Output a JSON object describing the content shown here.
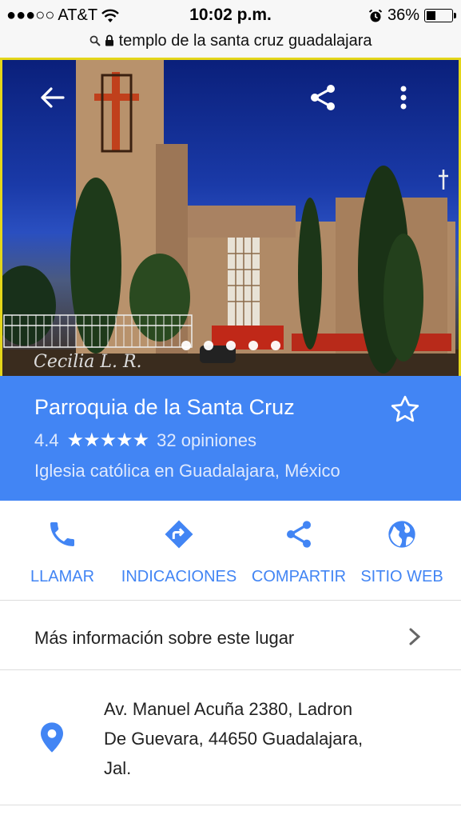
{
  "status_bar": {
    "signal": "●●●○○",
    "carrier": "AT&T",
    "time": "10:02 p.m.",
    "battery_percent": "36%",
    "battery_level": 0.36
  },
  "url_bar": {
    "query": "templo de la santa cruz guadalajara"
  },
  "hero": {
    "watermark": "Cecilia L. R.",
    "photo_count": 5,
    "active_photo": 0
  },
  "place": {
    "name": "Parroquia de la Santa Cruz",
    "rating": "4.4",
    "stars": "★★★★★",
    "reviews": "32 opiniones",
    "category": "Iglesia católica en Guadalajara, México"
  },
  "actions": {
    "call": "LLAMAR",
    "directions": "INDICACIONES",
    "share": "COMPARTIR",
    "website": "SITIO WEB"
  },
  "more_info": "Más información sobre este lugar",
  "address": {
    "line1": "Av. Manuel Acuña 2380, Ladron",
    "line2": "De Guevara, 44650 Guadalajara,",
    "line3": "Jal."
  },
  "colors": {
    "accent": "#4285f4",
    "photo_frame": "#e4d61a"
  }
}
